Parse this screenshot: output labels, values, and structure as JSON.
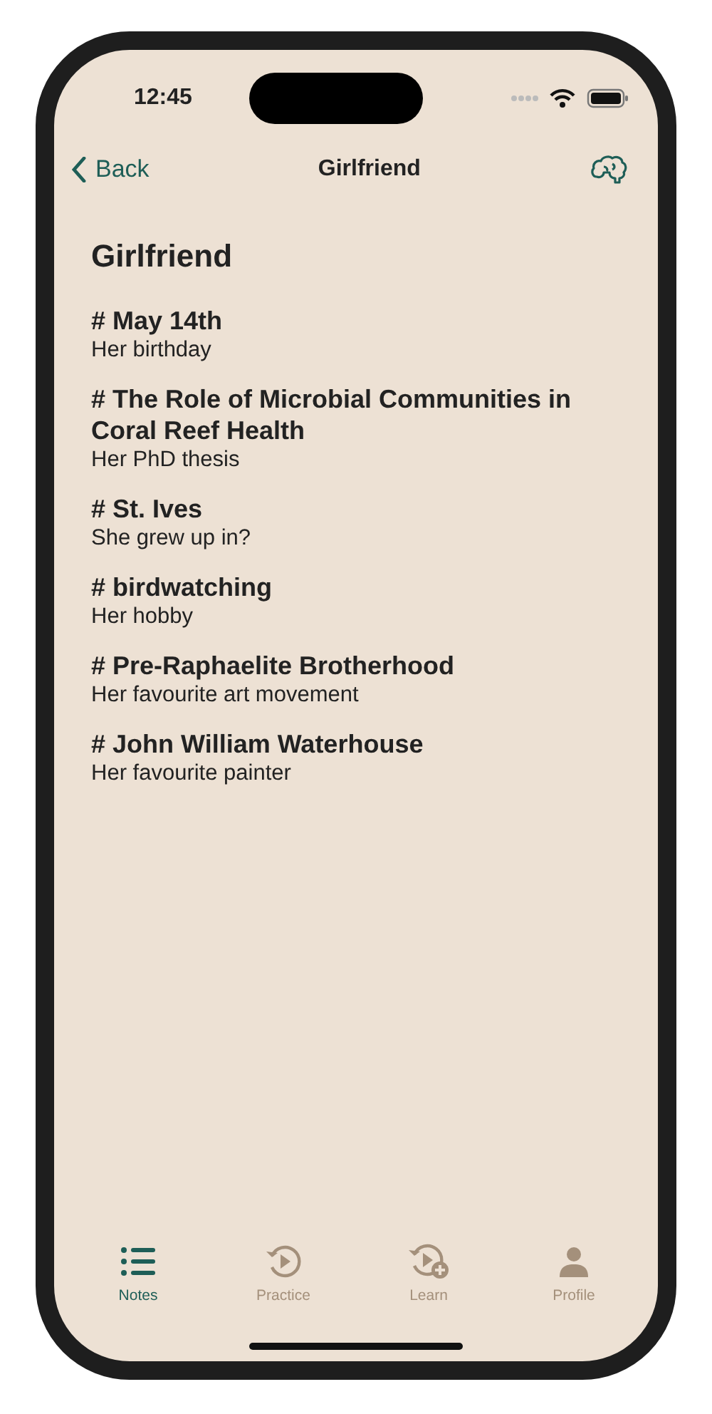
{
  "status_bar": {
    "time": "12:45"
  },
  "nav": {
    "back": "Back",
    "title": "Girlfriend"
  },
  "heading": "Girlfriend",
  "notes": [
    {
      "title": "# May 14th",
      "subtitle": "Her birthday"
    },
    {
      "title": "# The Role of Microbial Communities in Coral Reef Health",
      "subtitle": "Her PhD thesis"
    },
    {
      "title": "# St. Ives",
      "subtitle": "She grew up in?"
    },
    {
      "title": "# birdwatching",
      "subtitle": "Her hobby"
    },
    {
      "title": "# Pre-Raphaelite Brotherhood",
      "subtitle": "Her favourite art movement"
    },
    {
      "title": "# John William Waterhouse",
      "subtitle": "Her favourite painter"
    }
  ],
  "tabs": [
    {
      "kind": "notes",
      "label": "Notes",
      "selected": true
    },
    {
      "kind": "practice",
      "label": "Practice",
      "selected": false
    },
    {
      "kind": "learn",
      "label": "Learn",
      "selected": false
    },
    {
      "kind": "profile",
      "label": "Profile",
      "selected": false
    }
  ]
}
